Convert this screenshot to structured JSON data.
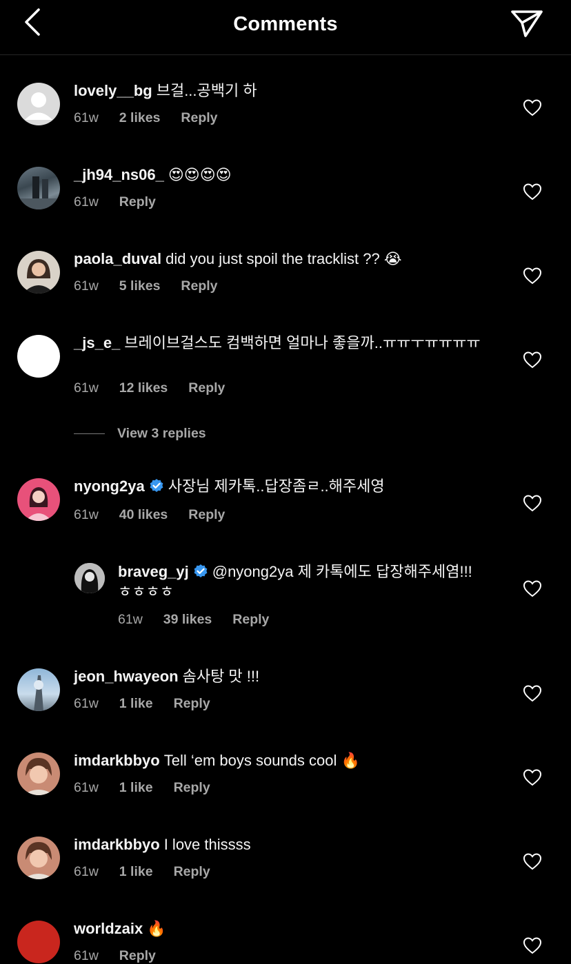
{
  "header": {
    "title": "Comments"
  },
  "comments": [
    {
      "username": "lovely__bg",
      "text": "브걸...공백기 하",
      "time": "61w",
      "likes": "2 likes",
      "reply": "Reply",
      "verified": false
    },
    {
      "username": "_jh94_ns06_",
      "text": "😍😍😍😍",
      "time": "61w",
      "likes": "",
      "reply": "Reply",
      "verified": false
    },
    {
      "username": "paola_duval",
      "text": "did you just spoil the tracklist ?? 😭",
      "time": "61w",
      "likes": "5 likes",
      "reply": "Reply",
      "verified": false
    },
    {
      "username": "_js_e_",
      "text": "브레이브걸스도 컴백하면 얼마나 좋을까..ㅠㅠㅜㅠㅠㅠㅠ",
      "time": "61w",
      "likes": "12 likes",
      "reply": "Reply",
      "verified": false
    },
    {
      "username": "nyong2ya",
      "text": "사장님 제카톡..답장좀ㄹ..해주세영",
      "time": "61w",
      "likes": "40 likes",
      "reply": "Reply",
      "verified": true
    },
    {
      "username": "braveg_yj",
      "text": "@nyong2ya 제 카톡에도 답장해주세염!!!ㅎㅎㅎㅎ",
      "time": "61w",
      "likes": "39 likes",
      "reply": "Reply",
      "verified": true
    },
    {
      "username": "jeon_hwayeon",
      "text": "솜사탕 맛 !!!",
      "time": "61w",
      "likes": "1 like",
      "reply": "Reply",
      "verified": false
    },
    {
      "username": "imdarkbbyo",
      "text": "Tell ‘em boys sounds cool 🔥",
      "time": "61w",
      "likes": "1 like",
      "reply": "Reply",
      "verified": false
    },
    {
      "username": "imdarkbbyo",
      "text": "I love thissss",
      "time": "61w",
      "likes": "1 like",
      "reply": "Reply",
      "verified": false
    },
    {
      "username": "worldzaix",
      "text": "🔥",
      "time": "61w",
      "likes": "",
      "reply": "Reply",
      "verified": false
    }
  ],
  "view_replies": "View 3 replies",
  "colors": {
    "background": "#000000",
    "meta": "#a8a8a8",
    "verified": "#3897f0"
  }
}
